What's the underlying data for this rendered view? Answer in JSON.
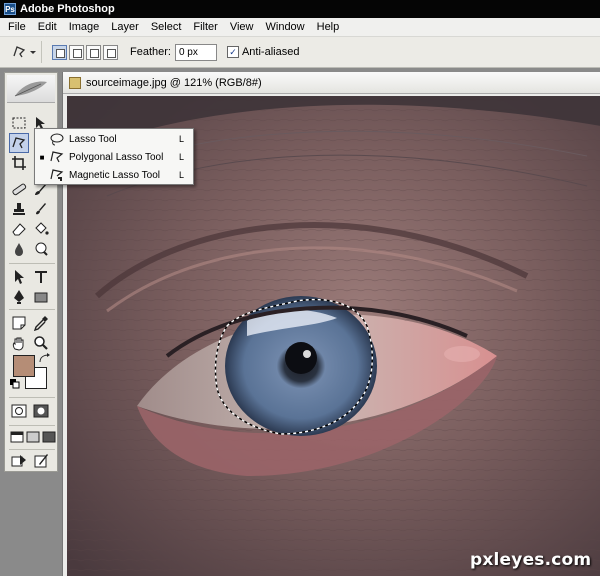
{
  "window": {
    "title": "Adobe Photoshop",
    "app_icon": "Ps"
  },
  "menu": [
    "File",
    "Edit",
    "Image",
    "Layer",
    "Select",
    "Filter",
    "View",
    "Window",
    "Help"
  ],
  "options": {
    "feather_label": "Feather:",
    "feather_value": "0 px",
    "antialiased_label": "Anti-aliased",
    "antialiased_checked": true,
    "check_mark": "✓"
  },
  "document": {
    "title": "sourceimage.jpg @ 121% (RGB/8#)"
  },
  "lasso_menu": [
    {
      "label": "Lasso Tool",
      "shortcut": "L",
      "active": false,
      "bullet": ""
    },
    {
      "label": "Polygonal Lasso Tool",
      "shortcut": "L",
      "active": true,
      "bullet": "■"
    },
    {
      "label": "Magnetic Lasso Tool",
      "shortcut": "L",
      "active": false,
      "bullet": ""
    }
  ],
  "colors": {
    "foreground": "#b58d76",
    "background": "#ffffff",
    "selection_highlight": "#c4d2ea"
  },
  "watermark": "pxleyes.com"
}
